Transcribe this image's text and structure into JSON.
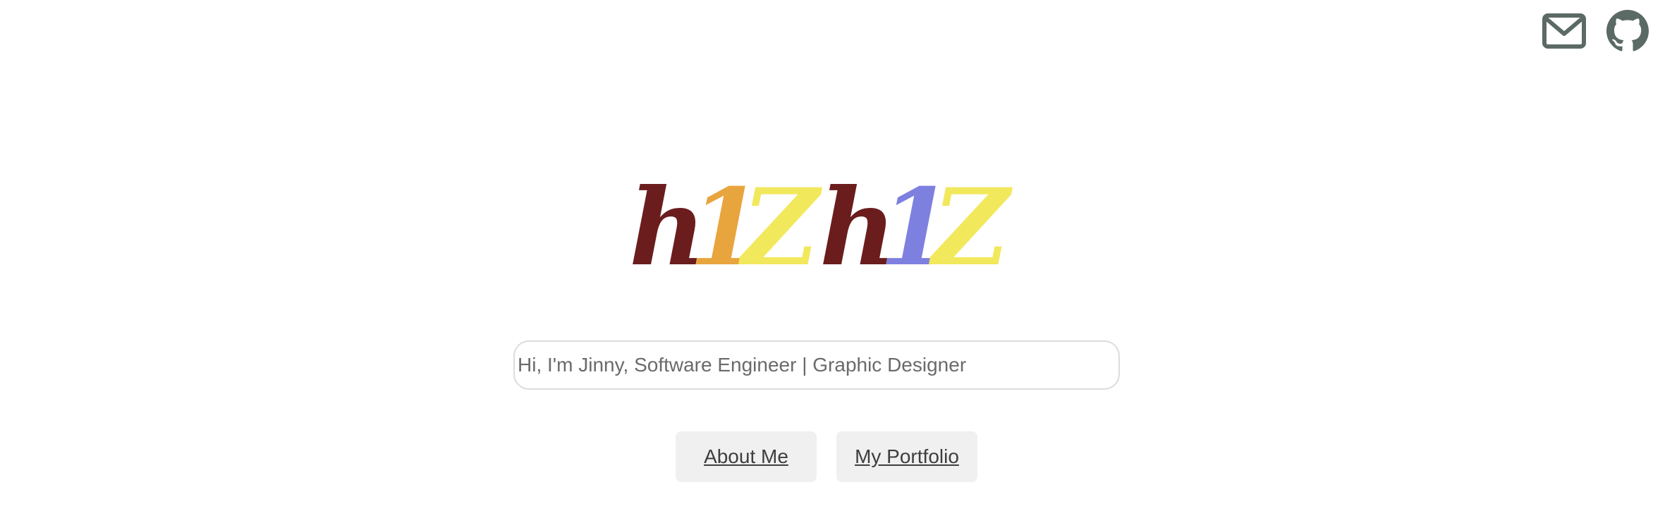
{
  "header": {
    "icons": [
      {
        "name": "mail-icon",
        "color": "#5c6a66"
      },
      {
        "name": "github-icon",
        "color": "#5c6a66"
      }
    ]
  },
  "logo": {
    "glyphs": [
      {
        "char": "h",
        "color": "#6b1d1d"
      },
      {
        "char": "1",
        "color": "#e8a53e"
      },
      {
        "char": "Z",
        "color": "#f2e85c"
      },
      {
        "char": "h",
        "color": "#6b1d1d"
      },
      {
        "char": "1",
        "color": "#7e80e0"
      },
      {
        "char": "Z",
        "color": "#f2e85c"
      }
    ]
  },
  "search": {
    "placeholder": "Hi, I'm Jinny, Software Engineer | Graphic Designer"
  },
  "nav": {
    "about_label": "About Me",
    "portfolio_label": "My Portfolio"
  }
}
